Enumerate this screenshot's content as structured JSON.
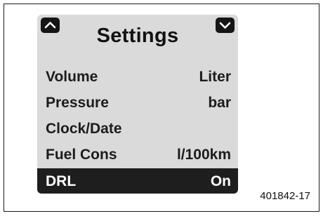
{
  "screen": {
    "title": "Settings",
    "nav": {
      "up_icon": "chevron-up-icon",
      "down_icon": "chevron-down-icon"
    },
    "items": [
      {
        "label": "Volume",
        "value": "Liter",
        "selected": false
      },
      {
        "label": "Pressure",
        "value": "bar",
        "selected": false
      },
      {
        "label": "Clock/Date",
        "value": "",
        "selected": false
      },
      {
        "label": "Fuel Cons",
        "value": "l/100km",
        "selected": false
      },
      {
        "label": "DRL",
        "value": "On",
        "selected": true
      }
    ]
  },
  "figure_id": "401842-17",
  "colors": {
    "screen_background": "#dadada",
    "selected_row": "#1e1e1e",
    "text": "#1c1c1c"
  }
}
